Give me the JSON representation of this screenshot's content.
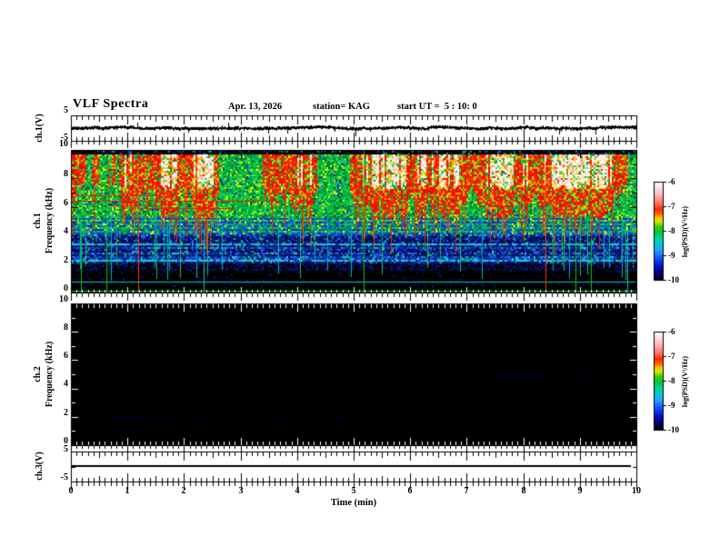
{
  "header": {
    "title": "VLF Spectra",
    "date": "Apr. 13, 2026",
    "station": "station= KAG",
    "start_ut": "start UT =  5 : 10: 0"
  },
  "x_axis": {
    "title": "Time (min)",
    "tick_labels": [
      "0",
      "1",
      "2",
      "3",
      "4",
      "5",
      "6",
      "7",
      "8",
      "9",
      "10"
    ]
  },
  "panels": {
    "ch1v": {
      "axis_label": "ch.1(V)",
      "tick_labels": [
        "5",
        "-5"
      ]
    },
    "spec1": {
      "channel_label": "ch.1",
      "freq_label": "Frequency (kHz)",
      "tick_labels": [
        "10",
        "8",
        "6",
        "4",
        "2",
        "0"
      ]
    },
    "spec2": {
      "channel_label": "ch.2",
      "freq_label": "Frequency (kHz)",
      "tick_labels": [
        "10",
        "8",
        "6",
        "4",
        "2",
        "0"
      ]
    },
    "ch3v": {
      "axis_label": "ch.3(V)",
      "tick_labels": [
        "5",
        "-5"
      ]
    }
  },
  "colorbar": {
    "label": "log(PSD)(V²/Hz)",
    "tick_labels": [
      "-6",
      "-7",
      "-8",
      "-9",
      "-10"
    ]
  },
  "chart_data": {
    "type": "heatmap",
    "title": "VLF Spectra",
    "station": "KAG",
    "date": "Apr. 13, 2026",
    "start_ut": "5:10:0",
    "x": {
      "label": "Time (min)",
      "range_min": [
        0,
        10
      ],
      "major_tick_min": 1,
      "minor_tick_min": 0.1
    },
    "panels": [
      {
        "name": "ch.1 waveform",
        "kind": "line",
        "units": "V",
        "y_range": [
          -5,
          5
        ],
        "description": "dense noisy trace centered on 0 V with about ±0.5 V jitter and occasional small spikes"
      },
      {
        "name": "ch.1 spectrogram",
        "kind": "spectrogram",
        "y_range_khz": [
          0,
          10
        ],
        "z_label": "log(PSD)(V²/Hz)",
        "z_range": [
          -10,
          -6
        ],
        "bands": [
          {
            "f_khz": [
              9.75,
              10
            ],
            "appearance": "near-black edge strip with sparse blue/green specks"
          },
          {
            "f_khz": [
              5.2,
              9.75
            ],
            "appearance": "green background near -8 filled with dense vertical red/white sferic streaks near -6"
          },
          {
            "f_khz": [
              4.05,
              5.2
            ],
            "appearance": "alternating dotted green/blue rows"
          },
          {
            "f_khz": [
              2.0,
              4.05
            ],
            "appearance": "blue near -9 with horizontal cyan banding"
          },
          {
            "f_khz": [
              1.6,
              2.0
            ],
            "appearance": "very dark navy"
          },
          {
            "f_khz": [
              0,
              1.6
            ],
            "appearance": "black near -10"
          }
        ],
        "horizontal_lines": [
          {
            "f_khz": 6.8,
            "t_min": [
              0.1,
              1.6
            ],
            "color": "#e61e00"
          },
          {
            "f_khz": 6.45,
            "t_min": [
              0.0,
              3.7
            ],
            "color": "#e61e00"
          },
          {
            "f_khz": 6.1,
            "t_min": [
              0.65,
              1.6
            ],
            "color": "#e61e00"
          },
          {
            "f_khz": 5.95,
            "t_min": [
              1.2,
              2.9
            ],
            "color": "#e61e00"
          },
          {
            "f_khz": 5.1,
            "t_min": [
              0,
              10
            ],
            "color": "#b4dc00",
            "style": "dashed"
          },
          {
            "f_khz": 0.76,
            "t_min": [
              0,
              10
            ],
            "color": "#00c8dc"
          },
          {
            "f_khz": 0.13,
            "t_min": [
              0,
              10
            ],
            "color": "#00c814"
          }
        ],
        "vertical_lines": [
          {
            "t_min": 0.18,
            "f_top_khz": 6.8,
            "color": "#00c814"
          },
          {
            "t_min": 0.63,
            "f_top_khz": 6.8,
            "color": "#00c814"
          },
          {
            "t_min": 1.19,
            "f_top_khz": 8.4,
            "color": "#ff3c00"
          },
          {
            "t_min": 2.35,
            "f_top_khz": 4.4,
            "color": "#00c8dc"
          },
          {
            "t_min": 5.18,
            "f_top_khz": 10,
            "color": "#00c814"
          },
          {
            "t_min": 8.39,
            "f_top_khz": 9.2,
            "color": "#ff3c00"
          },
          {
            "t_min": 8.92,
            "f_top_khz": 3.8,
            "color": "#00c814"
          },
          {
            "t_min": 9.2,
            "f_top_khz": 3.8,
            "color": "#00c814"
          },
          {
            "t_min": 9.84,
            "f_top_khz": 4.4,
            "color": "#00c8dc"
          }
        ]
      },
      {
        "name": "ch.2 spectrogram",
        "kind": "spectrogram",
        "y_range_khz": [
          0,
          10
        ],
        "z_label": "log(PSD)(V²/Hz)",
        "z_range": [
          -10,
          -6
        ],
        "appearance": "no signal: uniform black near -10",
        "faint_rows": [
          {
            "f_khz": 5.0,
            "t_min": [
              7.35,
              9.85
            ]
          },
          {
            "f_khz": 2.0,
            "t_min": [
              0.7,
              4.8
            ]
          }
        ]
      },
      {
        "name": "ch.3 waveform",
        "kind": "line",
        "units": "V",
        "y_range": [
          -5,
          5
        ],
        "description": "flat line at 0 V"
      }
    ],
    "colormap_stops": [
      {
        "pos": 0,
        "color": "#ffffff"
      },
      {
        "pos": 0.06,
        "color": "#ffe1e1"
      },
      {
        "pos": 0.14,
        "color": "#ffb4b9"
      },
      {
        "pos": 0.22,
        "color": "#ff6e64"
      },
      {
        "pos": 0.28,
        "color": "#ff2800"
      },
      {
        "pos": 0.33,
        "color": "#ff6400"
      },
      {
        "pos": 0.37,
        "color": "#ffc800"
      },
      {
        "pos": 0.41,
        "color": "#c8e600"
      },
      {
        "pos": 0.46,
        "color": "#32d200"
      },
      {
        "pos": 0.52,
        "color": "#00c846"
      },
      {
        "pos": 0.58,
        "color": "#00d2a0"
      },
      {
        "pos": 0.64,
        "color": "#00c8dc"
      },
      {
        "pos": 0.7,
        "color": "#28a0ff"
      },
      {
        "pos": 0.78,
        "color": "#1450ff"
      },
      {
        "pos": 0.86,
        "color": "#0014c8"
      },
      {
        "pos": 0.93,
        "color": "#000078"
      },
      {
        "pos": 1,
        "color": "#000000"
      }
    ]
  }
}
